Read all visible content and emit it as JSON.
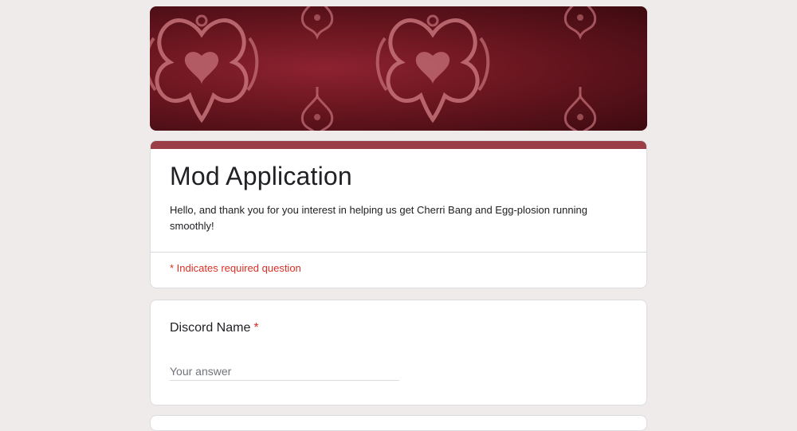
{
  "colors": {
    "page_background": "#f0ebeb",
    "accent": "#9c3e48",
    "banner_base": "#6a1620",
    "banner_ornament": "#c7727a",
    "required": "#d93025"
  },
  "header": {
    "title": "Mod Application",
    "description": "Hello, and thank you for you interest in helping us get Cherri Bang and Egg-plosion running smoothly!",
    "required_note": "* Indicates required question"
  },
  "questions": [
    {
      "label": "Discord Name",
      "required_marker": "*",
      "placeholder": "Your answer"
    }
  ]
}
